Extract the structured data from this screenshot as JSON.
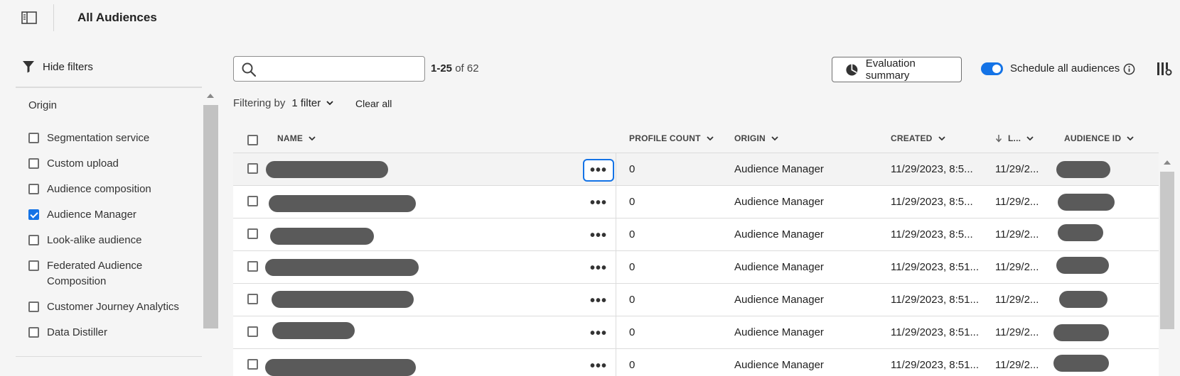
{
  "header": {
    "title": "All Audiences",
    "panel_toggle_icon": "panel-toggle-icon"
  },
  "filters": {
    "hide_label": "Hide filters",
    "icon": "funnel-icon",
    "origin_heading": "Origin",
    "origin_options": [
      {
        "label": "Segmentation service",
        "checked": false
      },
      {
        "label": "Custom upload",
        "checked": false
      },
      {
        "label": "Audience composition",
        "checked": false
      },
      {
        "label": "Audience Manager",
        "checked": true
      },
      {
        "label": "Look-alike audience",
        "checked": false
      },
      {
        "label": "Federated Audience Composition",
        "checked": false
      },
      {
        "label": "Customer Journey Analytics",
        "checked": false
      },
      {
        "label": "Data Distiller",
        "checked": false
      }
    ]
  },
  "toolbar": {
    "search_placeholder": "",
    "count_range": "1-25",
    "count_total": "of 62",
    "evaluation_summary_label": "Evaluation summary",
    "schedule_label": "Schedule all audiences",
    "schedule_enabled": true,
    "filtering_by_label": "Filtering by",
    "filter_count_label": "1 filter",
    "clear_all_label": "Clear all"
  },
  "table": {
    "columns": {
      "name": "NAME",
      "profile_count": "PROFILE COUNT",
      "origin": "ORIGIN",
      "created": "CREATED",
      "updated": "L...",
      "audience_id": "AUDIENCE ID"
    },
    "rows": [
      {
        "profile_count": "0",
        "origin": "Audience Manager",
        "created": "11/29/2023, 8:5...",
        "updated": "11/29/2...",
        "active": true
      },
      {
        "profile_count": "0",
        "origin": "Audience Manager",
        "created": "11/29/2023, 8:5...",
        "updated": "11/29/2...",
        "active": false
      },
      {
        "profile_count": "0",
        "origin": "Audience Manager",
        "created": "11/29/2023, 8:5...",
        "updated": "11/29/2...",
        "active": false
      },
      {
        "profile_count": "0",
        "origin": "Audience Manager",
        "created": "11/29/2023, 8:51...",
        "updated": "11/29/2...",
        "active": false
      },
      {
        "profile_count": "0",
        "origin": "Audience Manager",
        "created": "11/29/2023, 8:51...",
        "updated": "11/29/2...",
        "active": false
      },
      {
        "profile_count": "0",
        "origin": "Audience Manager",
        "created": "11/29/2023, 8:51...",
        "updated": "11/29/2...",
        "active": false
      },
      {
        "profile_count": "0",
        "origin": "Audience Manager",
        "created": "11/29/2023, 8:51...",
        "updated": "11/29/2...",
        "active": false
      }
    ]
  },
  "colors": {
    "accent": "#1473e6",
    "redaction": "#5a5a5a"
  }
}
